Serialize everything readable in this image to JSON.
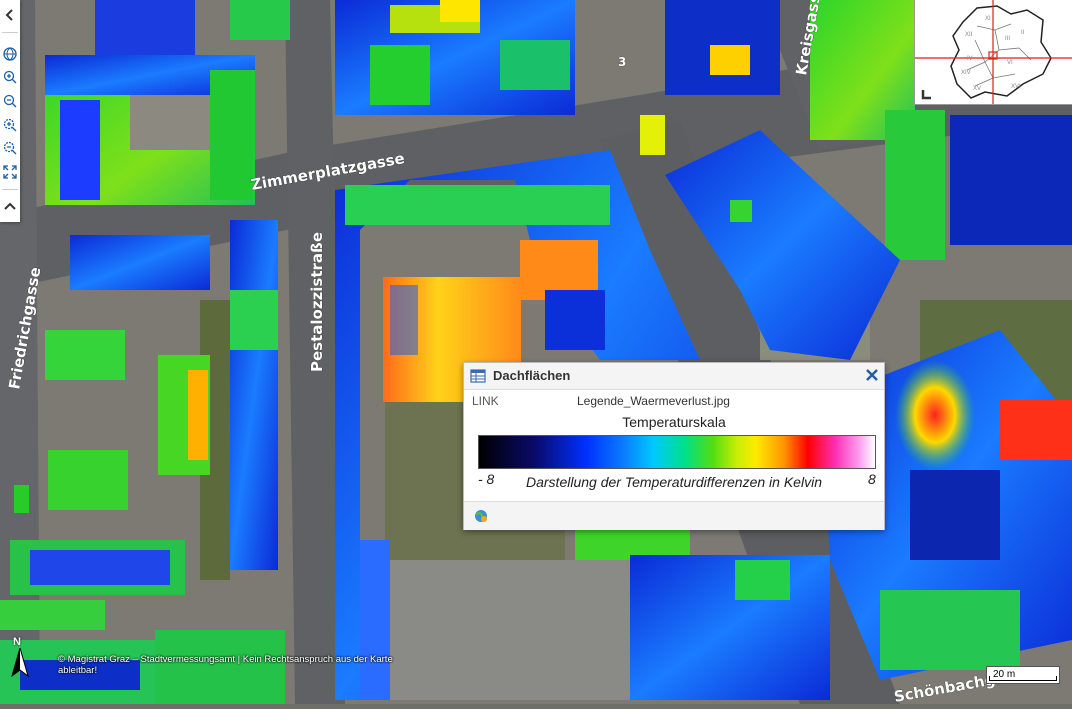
{
  "map": {
    "streets": {
      "zimmerplatzgasse": "Zimmerplatzgasse",
      "pestalozzistrasse": "Pestalozzistraße",
      "friedrichgasse": "Friedrichgasse",
      "kreisgasse": "Kreisgasse",
      "bottom": "Schönbachgasse"
    },
    "house_number": "3",
    "attribution": "© Magistrat Graz – Stadtvermessungsamt | Kein Rechtsanspruch aus der Karte ableitbar!",
    "scale_label": "20 m",
    "north_label": "N"
  },
  "toolbar": {
    "items": [
      {
        "icon": "chevron-left-icon",
        "name": "collapse-toolbar-button"
      },
      {
        "icon": "globe-icon",
        "name": "full-extent-button"
      },
      {
        "icon": "zoom-in-icon",
        "name": "zoom-in-button"
      },
      {
        "icon": "zoom-out-icon",
        "name": "zoom-out-button"
      },
      {
        "icon": "zoom-box-in-icon",
        "name": "zoom-box-in-button"
      },
      {
        "icon": "zoom-box-out-icon",
        "name": "zoom-box-out-button"
      },
      {
        "icon": "fit-extent-icon",
        "name": "fit-extent-button"
      },
      {
        "icon": "chevron-up-icon",
        "name": "collapse-tools-button"
      }
    ]
  },
  "overview": {
    "district_labels": [
      "XI",
      "XII",
      "III",
      "II",
      "VI",
      "IV",
      "XIV",
      "XV",
      "XVI"
    ]
  },
  "popup": {
    "title": "Dachflächen",
    "attribute_name": "LINK",
    "attribute_value": "Legende_Waermeverlust.jpg",
    "legend": {
      "title": "Temperaturskala",
      "min": "- 8",
      "max": "8",
      "caption": "Darstellung der Temperaturdifferenzen in Kelvin"
    }
  },
  "colors": {
    "cold": "#0a1fbf",
    "neutral": "#2fd42f",
    "warm": "#ffe600",
    "hot": "#ff1a1a"
  }
}
